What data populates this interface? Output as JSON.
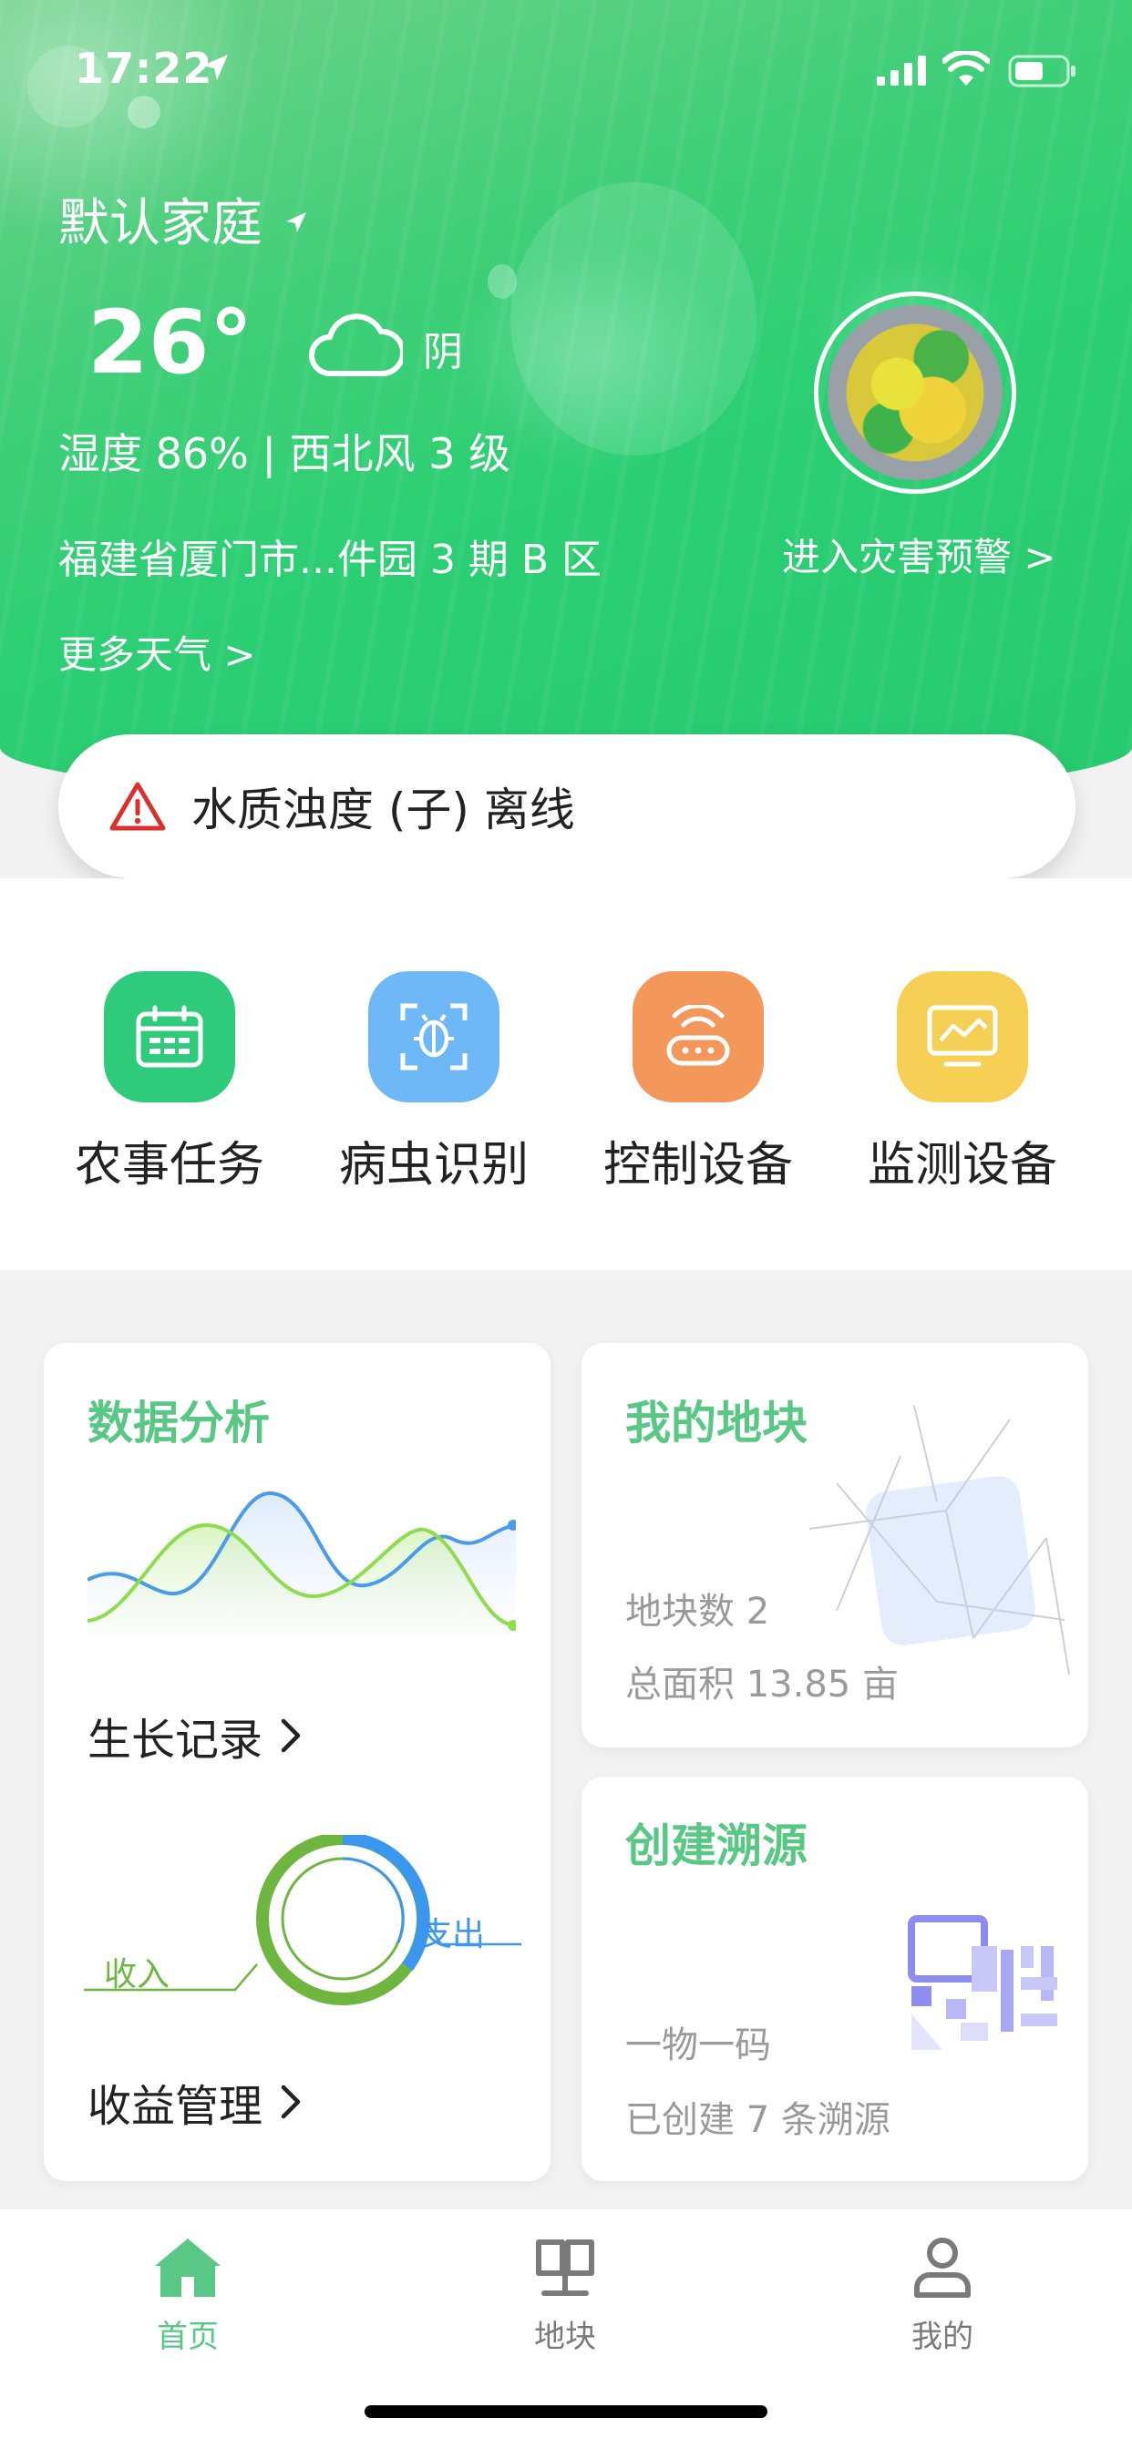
{
  "status_bar": {
    "time": "17:22"
  },
  "header": {
    "family": "默认家庭",
    "temperature": "26°",
    "condition": "阴",
    "humidity_wind": "湿度 86% | 西北风 3 级",
    "address": "福建省厦门市...件园 3 期 B 区",
    "more_weather": "更多天气 >",
    "disaster_warning": "进入灾害预警 >"
  },
  "alert": {
    "text": "水质浊度 (子) 离线"
  },
  "actions": [
    {
      "label": "农事任务",
      "color": "#2ecb7a"
    },
    {
      "label": "病虫识别",
      "color": "#6fb8f7"
    },
    {
      "label": "控制设备",
      "color": "#f4975a"
    },
    {
      "label": "监测设备",
      "color": "#f6cf55"
    }
  ],
  "cards": {
    "data_analysis": {
      "title": "数据分析",
      "growth_link": "生长记录",
      "income_label": "收入",
      "expense_label": "支出",
      "revenue_link": "收益管理"
    },
    "my_plots": {
      "title": "我的地块",
      "count": "地块数 2",
      "area": "总面积 13.85 亩"
    },
    "traceability": {
      "title": "创建溯源",
      "subtitle": "一物一码",
      "created": "已创建 7 条溯源"
    }
  },
  "tabbar": [
    {
      "label": "首页",
      "active": true
    },
    {
      "label": "地块",
      "active": false
    },
    {
      "label": "我的",
      "active": false
    }
  ],
  "colors": {
    "accent": "#58c884",
    "warning": "#d9322e",
    "tab_inactive": "#7a7a7a"
  }
}
